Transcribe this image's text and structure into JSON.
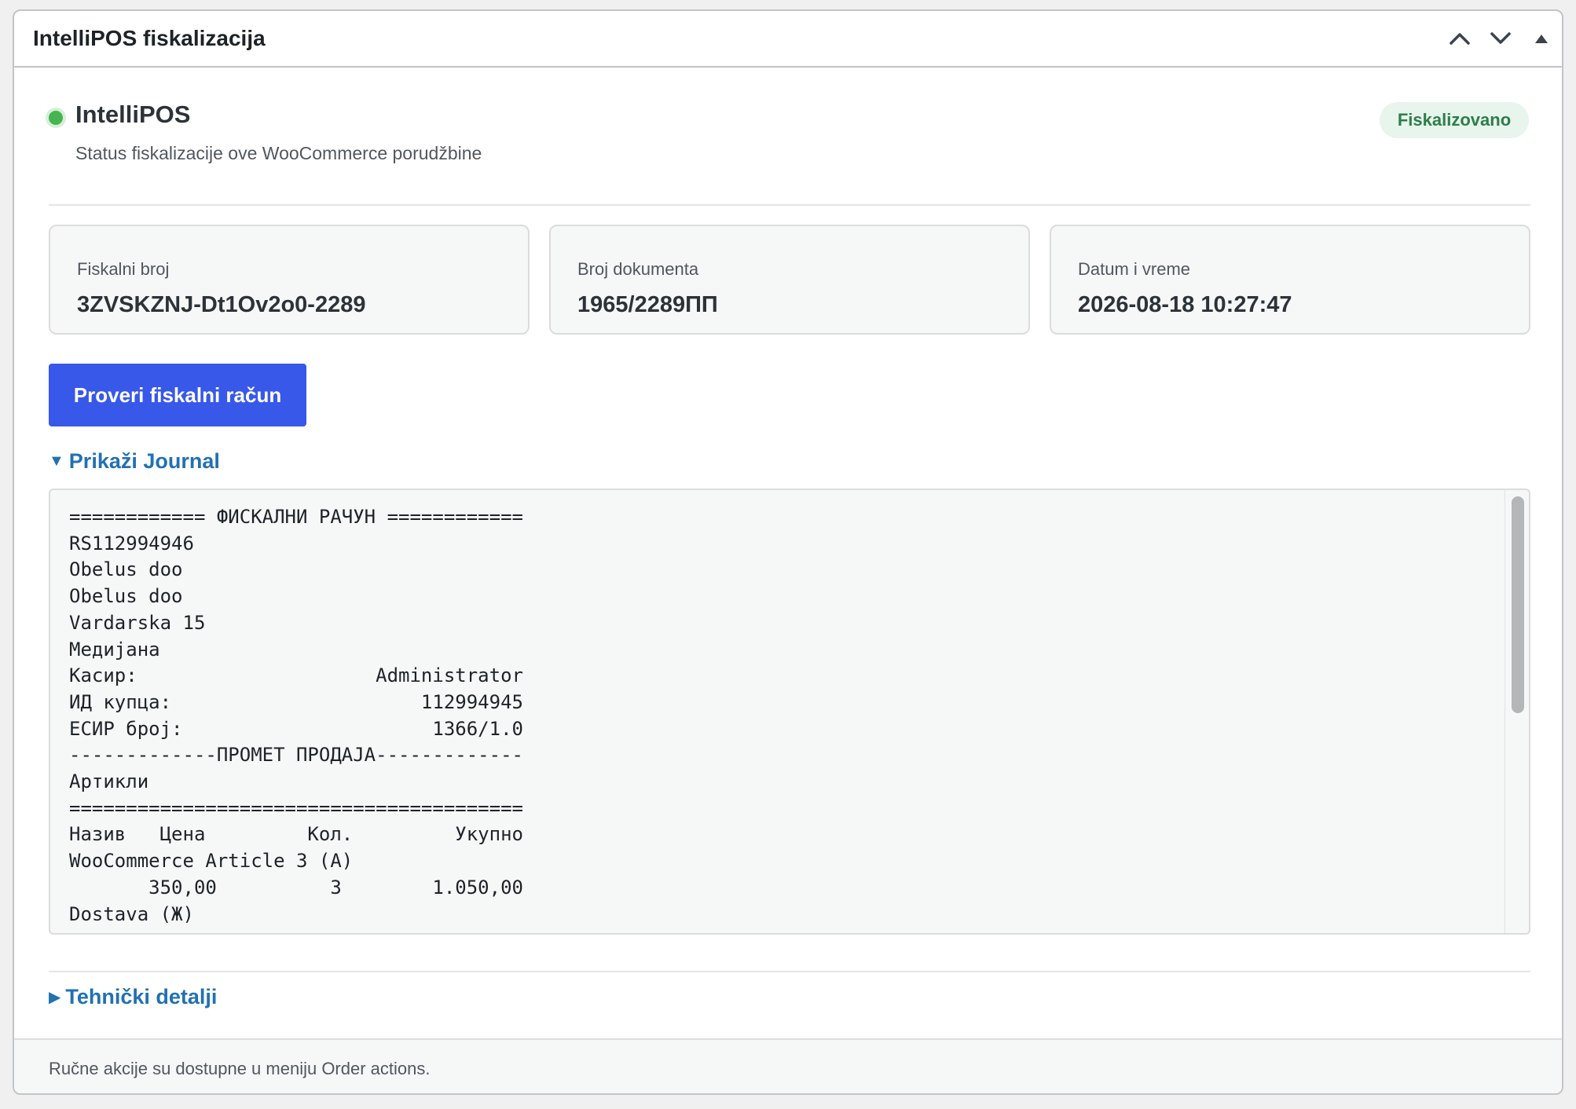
{
  "postbox": {
    "title": "IntelliPOS fiskalizacija",
    "controls": {
      "move_up_icon": "chevron-up-icon",
      "move_down_icon": "chevron-down-icon",
      "toggle_icon": "triangle-up-icon"
    }
  },
  "status": {
    "brand": "IntelliPOS",
    "subtitle": "Status fiskalizacije ove WooCommerce porudžbine",
    "badge": "Fiskalizovano",
    "indicator_color": "#46b450"
  },
  "cards": [
    {
      "label": "Fiskalni broj",
      "value": "3ZVSKZNJ-Dt1Ov2o0-2289"
    },
    {
      "label": "Broj dokumenta",
      "value": "1965/2289ПП"
    },
    {
      "label": "Datum i vreme",
      "value": "2026-08-18 10:27:47"
    }
  ],
  "actions": {
    "verify_button": "Proveri fiskalni račun"
  },
  "journal": {
    "toggle_label": "Prikaži Journal",
    "lines": [
      "============ ФИСКАЛНИ РАЧУН ============",
      "RS112994946",
      "Obelus doo",
      "Obelus doo",
      "Vardarska 15",
      "Медијана",
      "Касир:                     Administrator",
      "ИД купца:                      112994945",
      "ЕСИР број:                      1366/1.0",
      "-------------ПРОМЕТ ПРОДАЈА-------------",
      "Артикли",
      "========================================",
      "Назив   Цена         Кол.         Укупно",
      "WooCommerce Article 3 (А)",
      "       350,00          3        1.050,00",
      "Dostava (Ж)"
    ]
  },
  "technical": {
    "toggle_label": "Tehnički detalji"
  },
  "footer": {
    "note": "Ručne akcije su dostupne u meniju Order actions."
  },
  "colors": {
    "accent": "#3858e9",
    "link": "#2271b1",
    "success": "#2e7d4a"
  }
}
